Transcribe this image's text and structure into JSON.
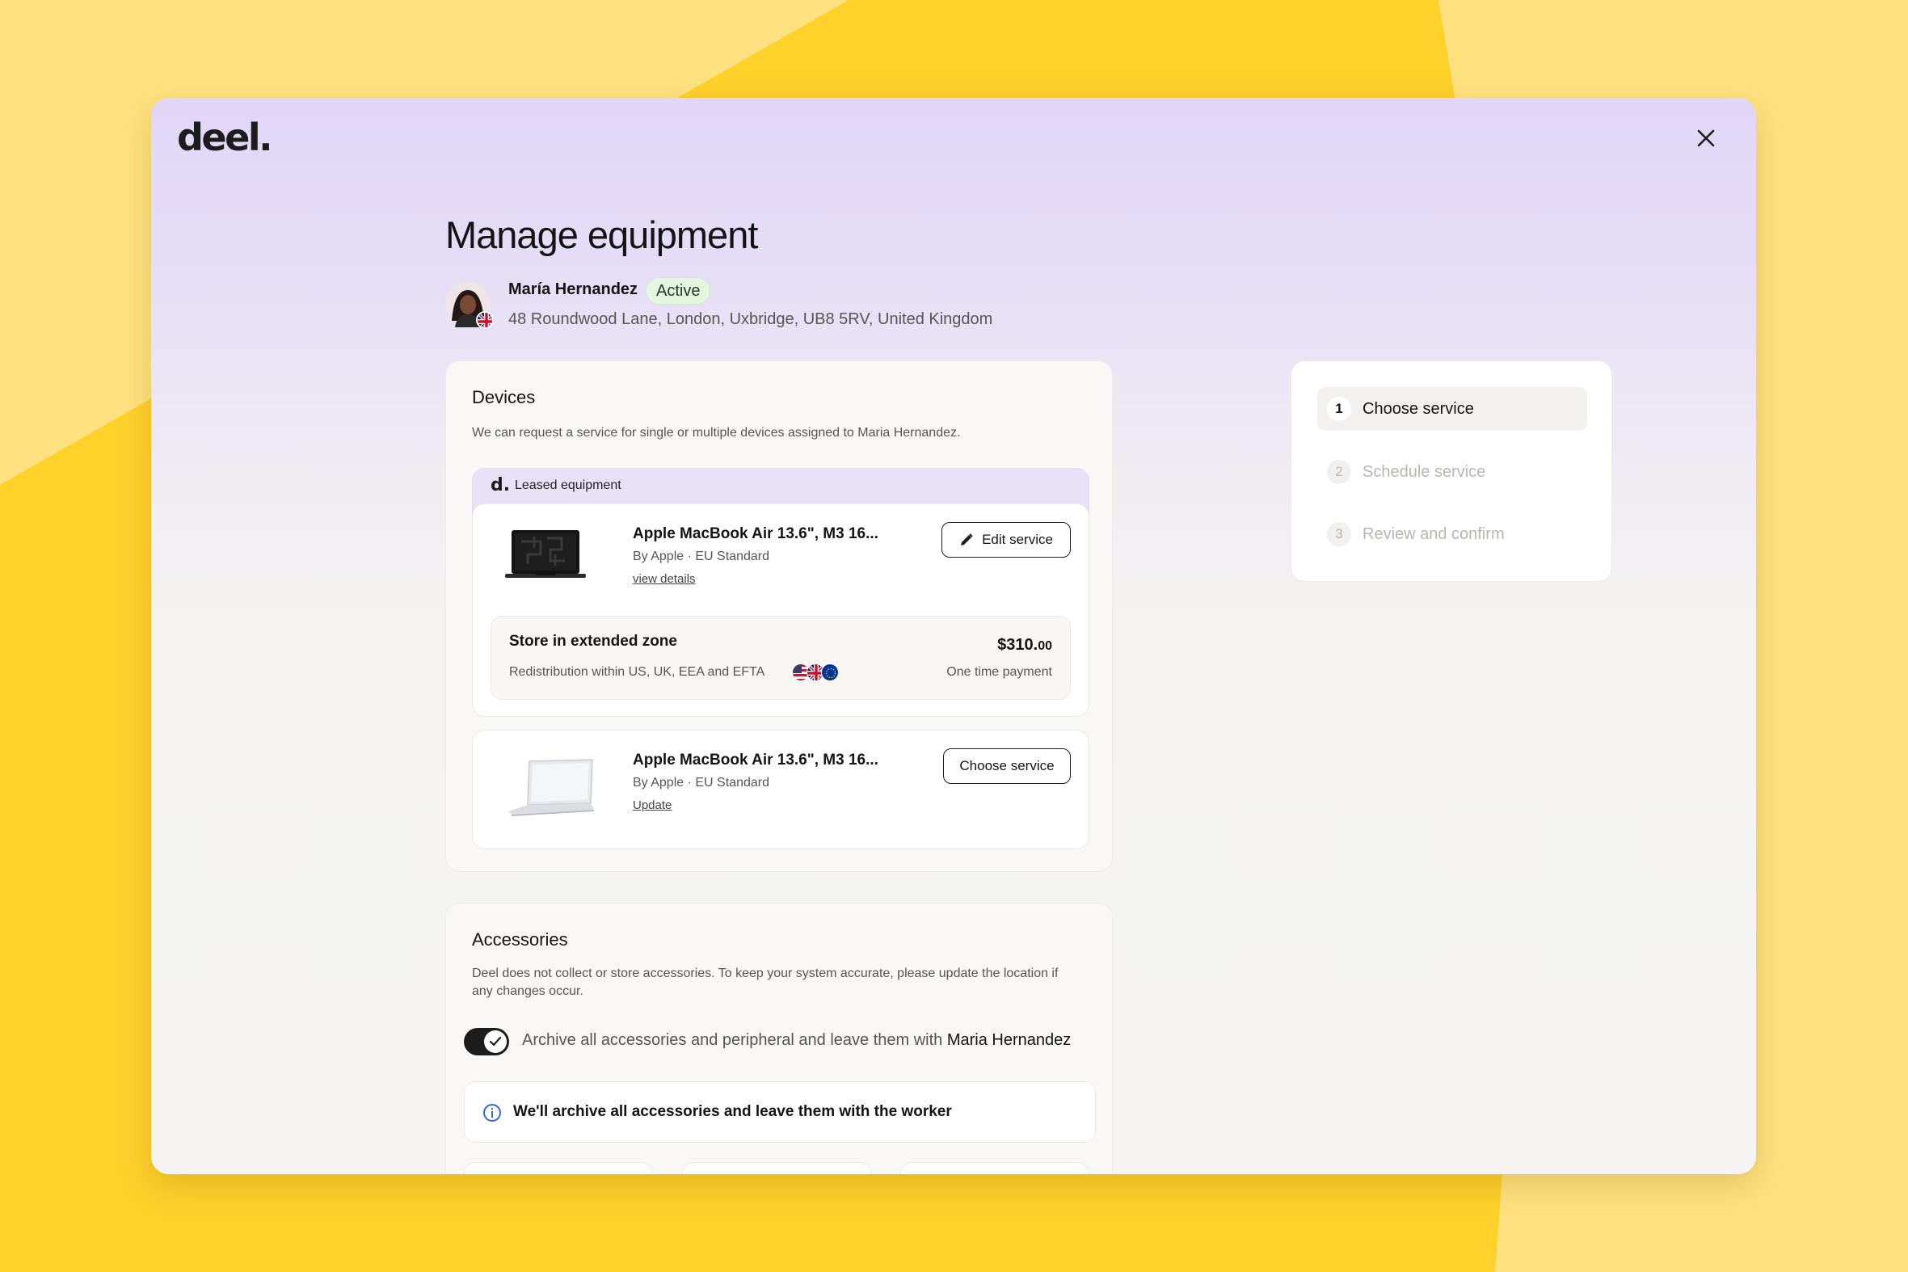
{
  "app": {
    "logo": "deel."
  },
  "header": {
    "title": "Manage equipment"
  },
  "user": {
    "name": "María Hernandez",
    "status": "Active",
    "address": "48 Roundwood Lane, London, Uxbridge, UB8 5RV, United Kingdom"
  },
  "devices": {
    "title": "Devices",
    "description": "We can request a service for single or multiple devices assigned to Maria Hernandez.",
    "leased_logo": "d.",
    "leased_label": "Leased equipment",
    "items": [
      {
        "name": "Apple MacBook Air 13.6\", M3 16...",
        "subtitle": "By Apple · EU Standard",
        "link": "view details",
        "button": "Edit service",
        "service": {
          "title": "Store in extended zone",
          "description": "Redistribution within US, UK, EEA and EFTA",
          "price_main": "$310.",
          "price_cents": "00",
          "price_note": "One time payment"
        }
      },
      {
        "name": "Apple MacBook Air 13.6\", M3 16...",
        "subtitle": "By Apple · EU Standard",
        "link": "Update",
        "button": "Choose service"
      }
    ]
  },
  "steps": [
    {
      "number": "1",
      "label": "Choose service",
      "active": true
    },
    {
      "number": "2",
      "label": "Schedule service",
      "active": false
    },
    {
      "number": "3",
      "label": "Review and confirm",
      "active": false
    }
  ],
  "accessories": {
    "title": "Accessories",
    "description": "Deel does not collect or store accessories. To keep your system accurate, please update the location if any changes occur.",
    "toggle_label": "Archive all accessories and peripheral and leave them with",
    "toggle_name": "Maria Hernandez",
    "toggle_on": true,
    "info_text": "We'll archive all accessories and leave them with the worker"
  },
  "colors": {
    "background": "#FFE27F",
    "accent_yellow": "#FFD12B",
    "header_lavender": "#E1D6F8",
    "status_green": "#E4F6E2",
    "info_blue": "#2F6BD8"
  }
}
